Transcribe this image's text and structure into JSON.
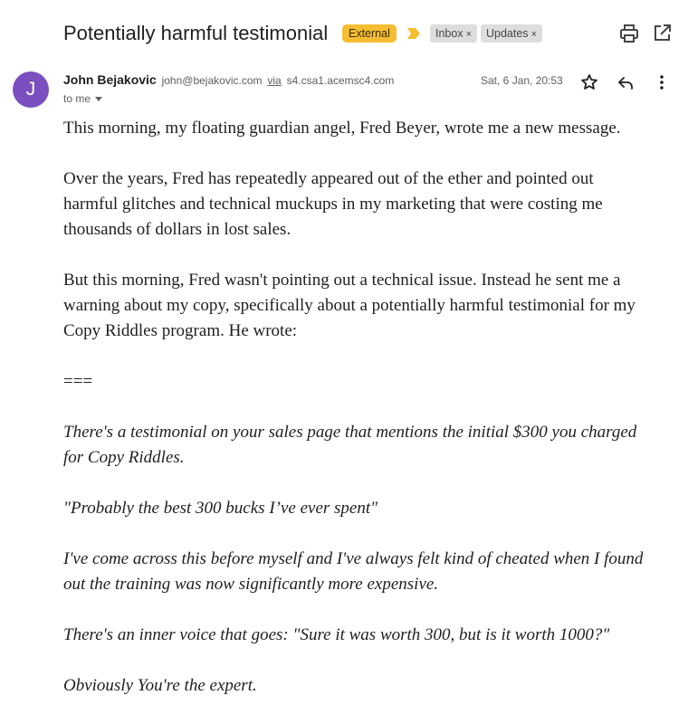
{
  "email": {
    "subject": "Potentially harmful testimonial",
    "external_badge": "External",
    "labels": [
      {
        "name": "Inbox",
        "remove": "×"
      },
      {
        "name": "Updates",
        "remove": "×"
      }
    ],
    "sender": {
      "initial": "J",
      "name": "John Bejakovic",
      "email": "john@bejakovic.com",
      "via_label": "via",
      "via_domain": "s4.csa1.acemsc4.com",
      "to": "to me",
      "date": "Sat, 6 Jan, 20:53",
      "avatar_color": "#7b4fc0"
    },
    "body": {
      "p1": "This morning, my floating guardian angel, Fred Beyer, wrote me a new message.",
      "p2": [
        "Over the years, Fred has repeatedly appeared out of the ether and pointed out",
        "harmful glitches and technical muckups in my marketing that were costing me",
        "thousands of dollars in lost sales."
      ],
      "p3": [
        "But this morning, Fred wasn't pointing out a technical issue. Instead he sent me a",
        "warning about my copy, specifically about a potentially harmful testimonial for my",
        "Copy Riddles program. He wrote:"
      ],
      "separator": "===",
      "q1": [
        "There's a testimonial on your sales page that mentions the initial $300 you charged",
        "for Copy Riddles."
      ],
      "q2": "\"Probably the best 300 bucks I’ve ever spent\"",
      "q3": [
        "I've come across this before myself and I've always felt kind of cheated when I found",
        "out the training was now significantly more expensive."
      ],
      "q4": "There's an inner voice that goes: \"Sure it was worth 300, but is it worth 1000?\"",
      "q5": "Obviously You're the expert."
    }
  },
  "icons": {
    "print": "printer-icon",
    "popout": "open-in-new-window-icon",
    "importance": "importance-marker-icon",
    "star": "star-icon",
    "reply": "reply-icon",
    "more": "more-vertical-icon"
  },
  "colors": {
    "external_badge": "#f5bd31",
    "importance_marker": "#f5bd31",
    "label_chip": "#dddddd"
  }
}
